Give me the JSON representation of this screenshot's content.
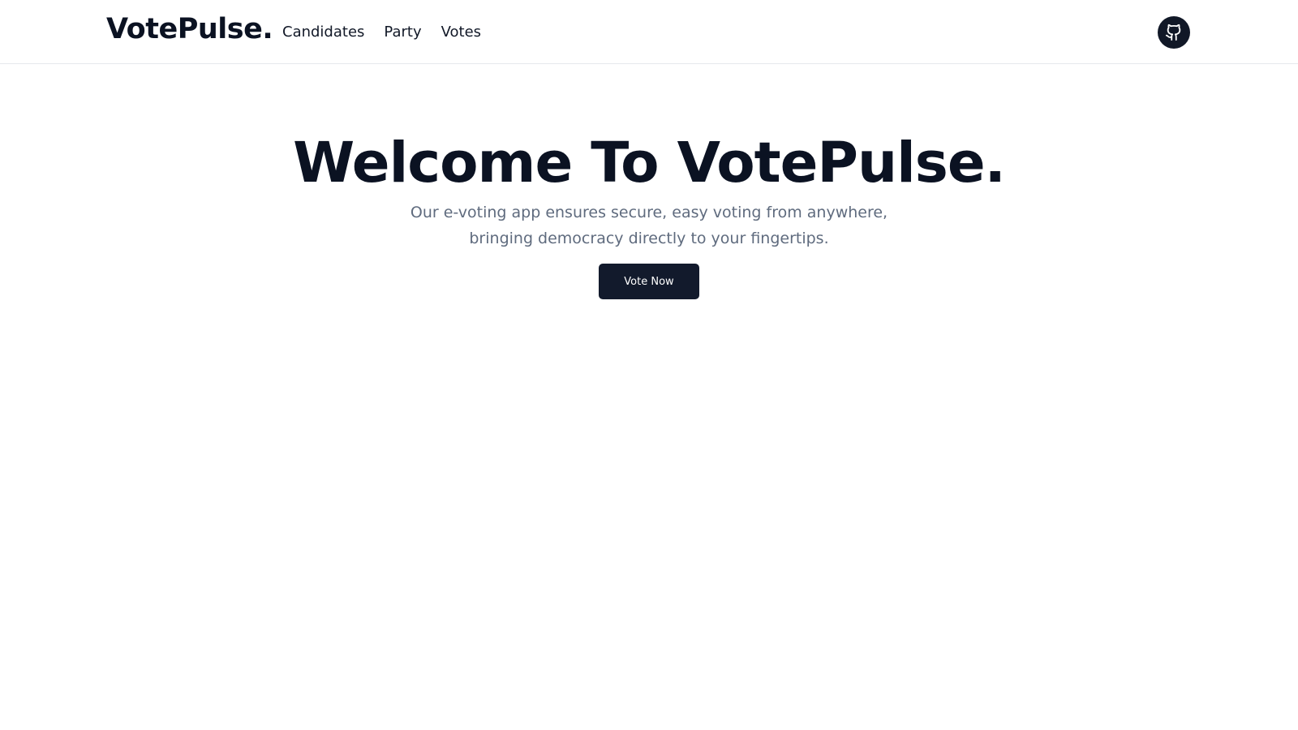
{
  "navbar": {
    "brand": "VotePulse.",
    "links": [
      {
        "label": "Candidates"
      },
      {
        "label": "Party"
      },
      {
        "label": "Votes"
      }
    ],
    "github_icon": "github-icon"
  },
  "hero": {
    "title": "Welcome To VotePulse.",
    "subtitle": "Our e-voting app ensures secure, easy voting from anywhere, bringing democracy directly to your fingertips.",
    "cta_label": "Vote Now"
  },
  "colors": {
    "primary": "#121a2c",
    "text": "#0b1222",
    "muted": "#5f6b7e",
    "border": "#e6e8ec"
  }
}
